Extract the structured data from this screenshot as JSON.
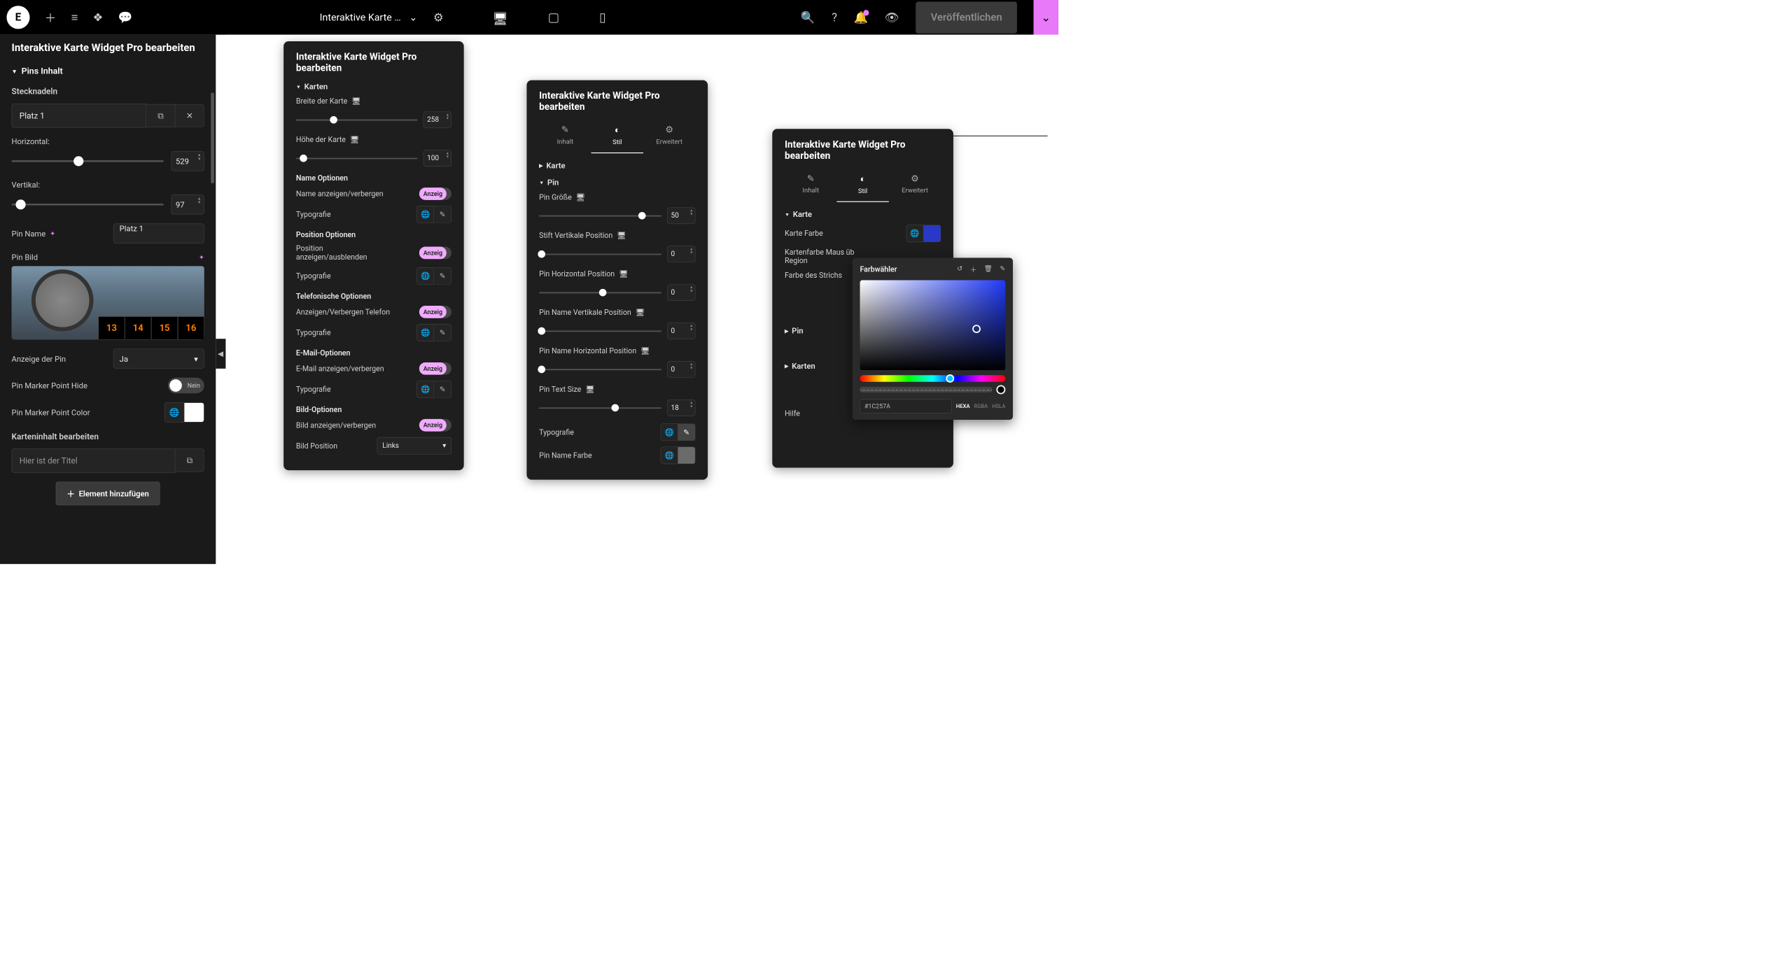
{
  "topbar": {
    "doc_title": "Interaktive Karte …",
    "publish_label": "Veröffentlichen"
  },
  "sidebar": {
    "title": "Interaktive Karte Widget Pro bearbeiten",
    "section_pins": "Pins Inhalt",
    "section_stick": "Stecknadeln",
    "item_name": "Platz 1",
    "horizontal_label": "Horizontal:",
    "horizontal_value": "529",
    "vertical_label": "Vertikal:",
    "vertical_value": "97",
    "pin_name_label": "Pin Name",
    "pin_name_value": "Platz 1",
    "pin_image_label": "Pin Bild",
    "display_pin_label": "Anzeige der Pin",
    "display_pin_value": "Ja",
    "marker_hide_label": "Pin Marker Point Hide",
    "marker_hide_value": "Nein",
    "marker_color_label": "Pin Marker Point Color",
    "card_content_label": "Karteninhalt bearbeiten",
    "card_title_placeholder": "Hier ist der Titel",
    "add_element_label": "Element hinzufügen",
    "calendar": [
      "13",
      "14",
      "15",
      "16"
    ]
  },
  "panel1": {
    "title": "Interaktive Karte Widget Pro bearbeiten",
    "sec_maps": "Karten",
    "width_label": "Breite der Karte",
    "width_value": "258",
    "height_label": "Höhe der Karte",
    "height_value": "100",
    "name_opts": "Name Optionen",
    "name_show": "Name anzeigen/verbergen",
    "typografie": "Typografie",
    "pos_opts": "Position Optionen",
    "pos_show": "Position anzeigen/ausblenden",
    "tel_opts": "Telefonische Optionen",
    "tel_show": "Anzeigen/Verbergen Telefon",
    "email_opts": "E-Mail-Optionen",
    "email_show": "E-Mail anzeigen/verbergen",
    "image_opts": "Bild-Optionen",
    "image_show": "Bild anzeigen/verbergen",
    "image_pos": "Bild Position",
    "image_pos_value": "Links",
    "pill_show": "Anzeig"
  },
  "panel2": {
    "title": "Interaktive Karte Widget Pro bearbeiten",
    "tab_content": "Inhalt",
    "tab_style": "Stil",
    "tab_advanced": "Erweitert",
    "sec_map": "Karte",
    "sec_pin": "Pin",
    "pin_size": "Pin Größe",
    "pin_size_value": "50",
    "pen_v": "Stift Vertikale Position",
    "pen_v_value": "0",
    "pin_h": "Pin Horizontal Position",
    "pin_h_value": "0",
    "pin_name_v": "Pin Name Vertikale Position",
    "pin_name_v_value": "0",
    "pin_name_h": "Pin Name Horizontal Position",
    "pin_name_h_value": "0",
    "pin_text": "Pin Text Size",
    "pin_text_value": "18",
    "typografie": "Typografie",
    "pin_name_color": "Pin Name Farbe"
  },
  "panel3": {
    "title": "Interaktive Karte Widget Pro bearbeiten",
    "tab_content": "Inhalt",
    "tab_style": "Stil",
    "tab_advanced": "Erweitert",
    "sec_map": "Karte",
    "map_color": "Karte Farbe",
    "map_hover": "Kartenfarbe Maus üb Region",
    "stroke_color": "Farbe des Strichs",
    "sec_pin": "Pin",
    "sec_cards": "Karten",
    "help": "Hilfe"
  },
  "colorpicker": {
    "title": "Farbwähler",
    "hex": "#1C257A",
    "fmt_hexa": "HEXA",
    "fmt_rgba": "RGBA",
    "fmt_hsla": "HSLA"
  }
}
